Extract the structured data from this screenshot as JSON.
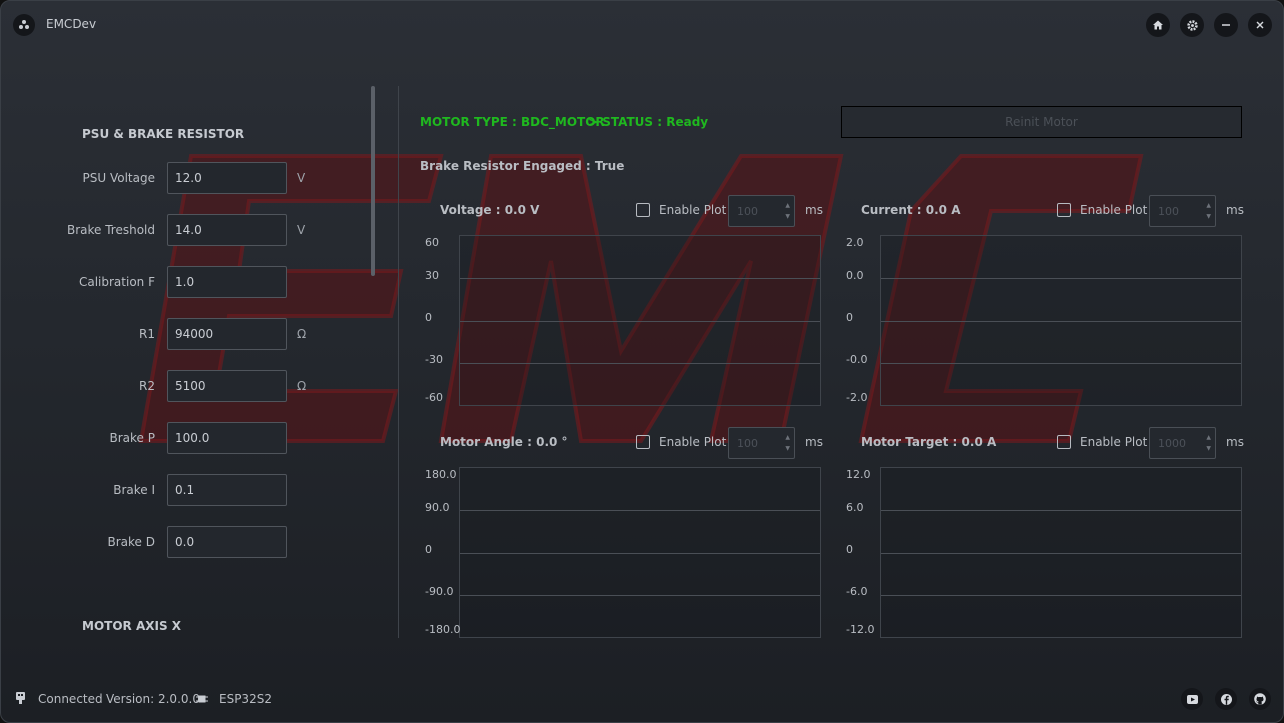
{
  "app": {
    "title": "EMCDev"
  },
  "left": {
    "section_psu": "PSU & BRAKE RESISTOR",
    "fields": [
      {
        "label": "PSU Voltage",
        "value": "12.0",
        "unit": "V"
      },
      {
        "label": "Brake Treshold",
        "value": "14.0",
        "unit": "V"
      },
      {
        "label": "Calibration F",
        "value": "1.0",
        "unit": ""
      },
      {
        "label": "R1",
        "value": "94000",
        "unit": "Ω"
      },
      {
        "label": "R2",
        "value": "5100",
        "unit": "Ω"
      },
      {
        "label": "Brake P",
        "value": "100.0",
        "unit": ""
      },
      {
        "label": "Brake I",
        "value": "0.1",
        "unit": ""
      },
      {
        "label": "Brake D",
        "value": "0.0",
        "unit": ""
      }
    ],
    "section_motor": "MOTOR AXIS X"
  },
  "right": {
    "motor_type": "MOTOR TYPE : BDC_MOTOR",
    "status": "> STATUS : Ready",
    "reinit_label": "Reinit Motor",
    "brake_engaged": "Brake Resistor Engaged : True",
    "enable_label": "Enable Plot",
    "ms_label": "ms",
    "plots": [
      {
        "title": "Voltage : 0.0 V",
        "interval": "100",
        "ticks": [
          "60",
          "30",
          "0",
          "-30",
          "-60"
        ]
      },
      {
        "title": "Current : 0.0 A",
        "interval": "100",
        "ticks": [
          "2.0",
          "0.0",
          "0",
          "-0.0",
          "-2.0"
        ]
      },
      {
        "title": "Motor Angle : 0.0 °",
        "interval": "100",
        "ticks": [
          "180.0",
          "90.0",
          "0",
          "-90.0",
          "-180.0"
        ]
      },
      {
        "title": "Motor Target : 0.0 A",
        "interval": "1000",
        "ticks": [
          "12.0",
          "6.0",
          "0",
          "-6.0",
          "-12.0"
        ]
      }
    ]
  },
  "statusbar": {
    "connected": "Connected",
    "version": "Version: 2.0.0.0",
    "chip": "ESP32S2"
  },
  "colors": {
    "status_green": "#1fb81f",
    "watermark_red": "#6b1418"
  }
}
